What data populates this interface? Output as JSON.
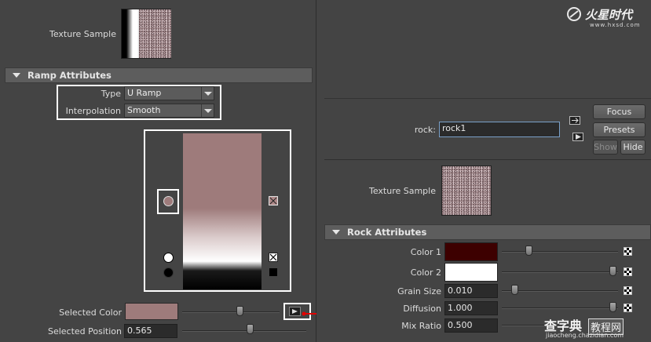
{
  "left": {
    "texture_sample_label": "Texture Sample",
    "ramp_section_title": "Ramp Attributes",
    "type_label": "Type",
    "type_value": "U Ramp",
    "interpolation_label": "Interpolation",
    "interpolation_value": "Smooth",
    "selected_color_label": "Selected Color",
    "selected_color_hex": "#9e7b7b",
    "selected_position_label": "Selected Position",
    "selected_position_value": "0.565"
  },
  "right": {
    "node_label": "rock:",
    "node_value": "rock1",
    "focus_label": "Focus",
    "presets_label": "Presets",
    "show_label": "Show",
    "hide_label": "Hide",
    "texture_sample_label": "Texture Sample",
    "rock_section_title": "Rock Attributes",
    "attributes": [
      {
        "label": "Color 1",
        "value": "",
        "color": "#3d0000"
      },
      {
        "label": "Color 2",
        "value": "",
        "color": "#ffffff"
      },
      {
        "label": "Grain Size",
        "value": "0.010"
      },
      {
        "label": "Diffusion",
        "value": "1.000"
      },
      {
        "label": "Mix Ratio",
        "value": "0.500"
      }
    ]
  },
  "watermark": {
    "brand": "火星时代",
    "site": "www.hxsd.com",
    "footer_brand": "查字典",
    "footer_sub": "教程网",
    "footer_url": "jiaocheng.chazidian.com"
  },
  "colors": {
    "ramp_top": "#9e7b7b",
    "ramp_mid": "#ffffff",
    "ramp_bottom": "#000000",
    "arrow_red": "#e00000"
  }
}
